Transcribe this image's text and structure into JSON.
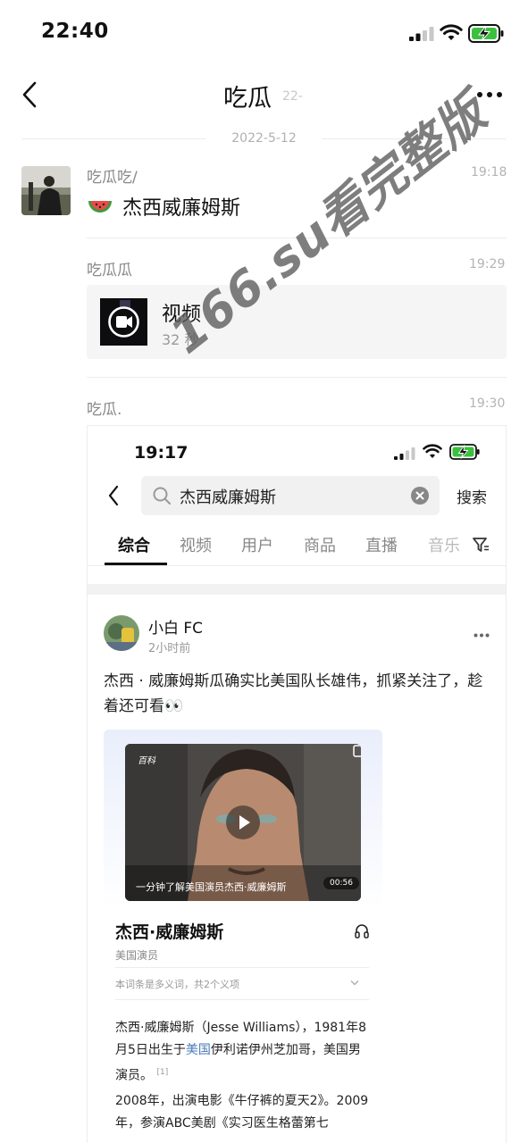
{
  "status_bar": {
    "time": "22:40"
  },
  "header": {
    "title": "吃瓜",
    "subtitle": "22-"
  },
  "date_divider": "2022-5-12",
  "messages": [
    {
      "sender": "吃瓜吃/",
      "time": "19:18",
      "text": "杰西威廉姆斯",
      "emoji": "watermelon-icon"
    },
    {
      "sender": "吃瓜瓜",
      "time": "19:29",
      "video": {
        "label": "视频",
        "duration": "32 秒"
      }
    },
    {
      "sender": "吃瓜.",
      "time": "19:30"
    }
  ],
  "embedded_screenshot": {
    "status_time": "19:17",
    "search": {
      "value": "杰西威廉姆斯",
      "button": "搜索"
    },
    "tabs": [
      "综合",
      "视频",
      "用户",
      "商品",
      "直播",
      "音乐"
    ],
    "active_tab": "综合",
    "post": {
      "user": "小白 FC",
      "time": "2小时前",
      "text": "杰西 · 威廉姆斯瓜确实比美国队长雄伟，抓紧关注了，趁着还可看👀"
    },
    "baike": {
      "logo": "百科",
      "video_caption": "一分钟了解美国演员杰西·威廉姆斯",
      "video_duration": "00:56",
      "name": "杰西·威廉姆斯",
      "category": "美国演员",
      "polysemy": "本词条是多义词，共2个义项",
      "desc_a": "杰西·威廉姆斯（Jesse Williams），1981年8月5日出生于",
      "desc_link1": "美国",
      "desc_b": "伊利诺伊州芝加哥，美国男演员。",
      "desc_ref": "[1]",
      "desc2_a": "2008年，出演电影《",
      "desc2_link1": "牛仔裤的夏天2",
      "desc2_b": "》。2009年，参演",
      "desc2_link2": "ABC",
      "desc2_c": "美剧《",
      "desc2_link3": "实习医生格蕾第七"
    }
  },
  "watermark": "166.su看完整版",
  "colors": {
    "link": "#4a7ab8",
    "battery": "#3cc03f"
  }
}
